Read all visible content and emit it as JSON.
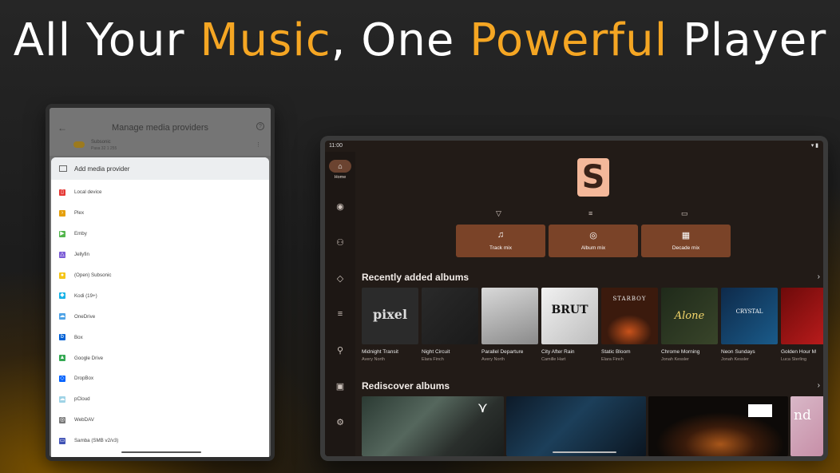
{
  "headline": {
    "part1": "All Your ",
    "accent1": "Music",
    "part2": ", One ",
    "accent2": "Powerful",
    "part3": " Player"
  },
  "left_tablet": {
    "title": "Manage media providers",
    "existing_provider": {
      "name": "Subsonic",
      "subtitle": "Pasa 32 1 255"
    },
    "sheet_header": "Add media provider",
    "providers": [
      {
        "label": "Local device",
        "icon": "phone-icon",
        "color": "#e53935"
      },
      {
        "label": "Plex",
        "icon": "plex-icon",
        "color": "#e5a00d"
      },
      {
        "label": "Emby",
        "icon": "emby-icon",
        "color": "#52b54b"
      },
      {
        "label": "Jellyfin",
        "icon": "jellyfin-icon",
        "color": "#7b5cd6"
      },
      {
        "label": "(Open) Subsonic",
        "icon": "subsonic-icon",
        "color": "#f5c518"
      },
      {
        "label": "Kodi (19+)",
        "icon": "kodi-icon",
        "color": "#17b2e7"
      },
      {
        "label": "OneDrive",
        "icon": "onedrive-icon",
        "color": "#4fa3e6"
      },
      {
        "label": "Box",
        "icon": "box-icon",
        "color": "#0061d5"
      },
      {
        "label": "Google Drive",
        "icon": "google-drive-icon",
        "color": "#34a853"
      },
      {
        "label": "DropBox",
        "icon": "dropbox-icon",
        "color": "#0061fe"
      },
      {
        "label": "pCloud",
        "icon": "pcloud-icon",
        "color": "#9fd3e6"
      },
      {
        "label": "WebDAV",
        "icon": "globe-icon",
        "color": "#777777"
      },
      {
        "label": "Samba (SMB v2/v3)",
        "icon": "samba-icon",
        "color": "#3f51b5"
      }
    ]
  },
  "right_tablet": {
    "status_time": "11:00",
    "nav_home_label": "Home",
    "mixes": [
      {
        "label": "Track mix",
        "icon": "track-mix-icon"
      },
      {
        "label": "Album mix",
        "icon": "album-mix-icon"
      },
      {
        "label": "Decade mix",
        "icon": "decade-mix-icon"
      }
    ],
    "recently_added_title": "Recently added albums",
    "rediscover_title": "Rediscover albums",
    "albums": [
      {
        "title": "Midnight Transit",
        "artist": "Avery North",
        "cover_text": "pixel"
      },
      {
        "title": "Night Circuit",
        "artist": "Elara Finch",
        "cover_text": ""
      },
      {
        "title": "Parallel Departure",
        "artist": "Avery North",
        "cover_text": ""
      },
      {
        "title": "City After Rain",
        "artist": "Camille Hart",
        "cover_text": "BRUT"
      },
      {
        "title": "Static Bloom",
        "artist": "Elara Finch",
        "cover_text": "STARBOY"
      },
      {
        "title": "Chrome Morning",
        "artist": "Jonah Kessler",
        "cover_text": "Alone"
      },
      {
        "title": "Neon Sundays",
        "artist": "Jonah Kessler",
        "cover_text": "CRYSTAL"
      },
      {
        "title": "Golden Hour M",
        "artist": "Luca Sterling",
        "cover_text": ""
      }
    ],
    "colors": {
      "accent": "#7a4328",
      "background": "#221b17",
      "headline_accent": "#f5a623"
    }
  }
}
